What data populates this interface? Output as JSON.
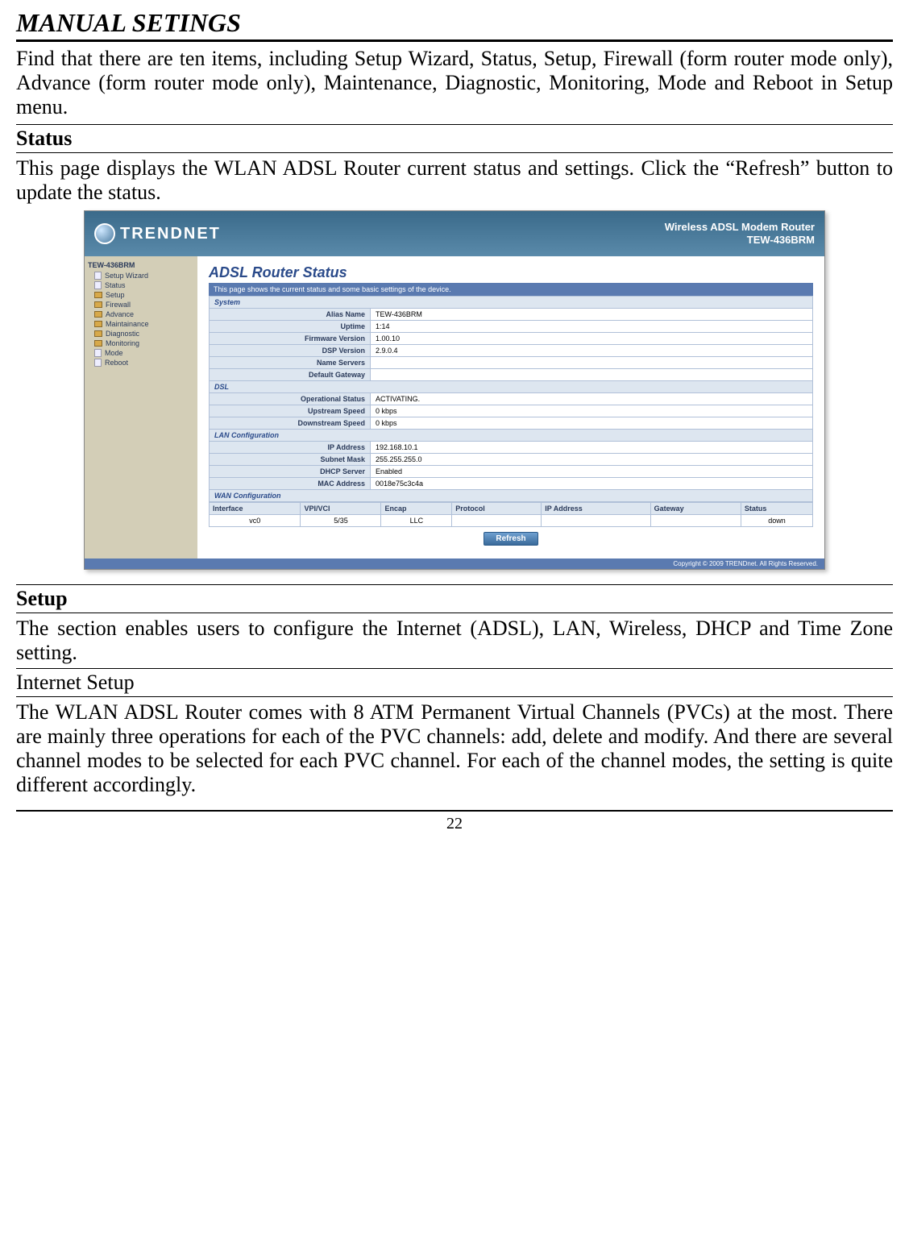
{
  "doc": {
    "title": "MANUAL SETINGS",
    "intro": "Find that there are ten items, including Setup Wizard, Status, Setup, Firewall (form router mode only), Advance (form router mode only), Maintenance, Diagnostic, Monitoring, Mode and Reboot in Setup menu.",
    "status_header": "Status",
    "status_text": "This page displays the WLAN ADSL Router current status and settings. Click the “Refresh” button to update the status.",
    "setup_header": "Setup",
    "setup_text": "The section enables users to configure the Internet (ADSL), LAN, Wireless, DHCP and Time Zone setting.",
    "internet_setup_header": "Internet Setup",
    "internet_setup_text": "The WLAN ADSL Router comes with 8 ATM Permanent Virtual Channels (PVCs) at the most. There are mainly three operations for each of the PVC channels: add, delete and modify. And there are several channel modes to be selected for each PVC channel. For each of the channel modes, the setting is quite different accordingly.",
    "page_number": "22"
  },
  "ui": {
    "brand": "TRENDNET",
    "product_line1": "Wireless ADSL Modem Router",
    "product_line2": "TEW-436BRM",
    "sidebar_title": "TEW-436BRM",
    "sidebar_items": [
      {
        "label": "Setup Wizard",
        "type": "page"
      },
      {
        "label": "Status",
        "type": "page"
      },
      {
        "label": "Setup",
        "type": "folder"
      },
      {
        "label": "Firewall",
        "type": "folder"
      },
      {
        "label": "Advance",
        "type": "folder"
      },
      {
        "label": "Maintainance",
        "type": "folder"
      },
      {
        "label": "Diagnostic",
        "type": "folder"
      },
      {
        "label": "Monitoring",
        "type": "folder"
      },
      {
        "label": "Mode",
        "type": "page"
      },
      {
        "label": "Reboot",
        "type": "page"
      }
    ],
    "main_title": "ADSL Router Status",
    "main_subtitle": "This page shows the current status and some basic settings of the device.",
    "groups": {
      "system": {
        "header": "System",
        "rows": [
          {
            "label": "Alias Name",
            "value": "TEW-436BRM"
          },
          {
            "label": "Uptime",
            "value": "1:14"
          },
          {
            "label": "Firmware Version",
            "value": "1.00.10"
          },
          {
            "label": "DSP Version",
            "value": "2.9.0.4"
          },
          {
            "label": "Name Servers",
            "value": ""
          },
          {
            "label": "Default Gateway",
            "value": ""
          }
        ]
      },
      "dsl": {
        "header": "DSL",
        "rows": [
          {
            "label": "Operational Status",
            "value": "ACTIVATING."
          },
          {
            "label": "Upstream Speed",
            "value": "0 kbps"
          },
          {
            "label": "Downstream Speed",
            "value": "0 kbps"
          }
        ]
      },
      "lan": {
        "header": "LAN Configuration",
        "rows": [
          {
            "label": "IP Address",
            "value": "192.168.10.1"
          },
          {
            "label": "Subnet Mask",
            "value": "255.255.255.0"
          },
          {
            "label": "DHCP Server",
            "value": "Enabled"
          },
          {
            "label": "MAC Address",
            "value": "0018e75c3c4a"
          }
        ]
      },
      "wan": {
        "header": "WAN Configuration",
        "cols": [
          "Interface",
          "VPI/VCI",
          "Encap",
          "Protocol",
          "IP Address",
          "Gateway",
          "Status"
        ],
        "row": {
          "iface": "vc0",
          "vpivci": "5/35",
          "encap": "LLC",
          "proto": "",
          "ip": "",
          "gw": "",
          "status": "down"
        }
      }
    },
    "refresh_label": "Refresh",
    "footer": "Copyright © 2009 TRENDnet. All Rights Reserved."
  }
}
